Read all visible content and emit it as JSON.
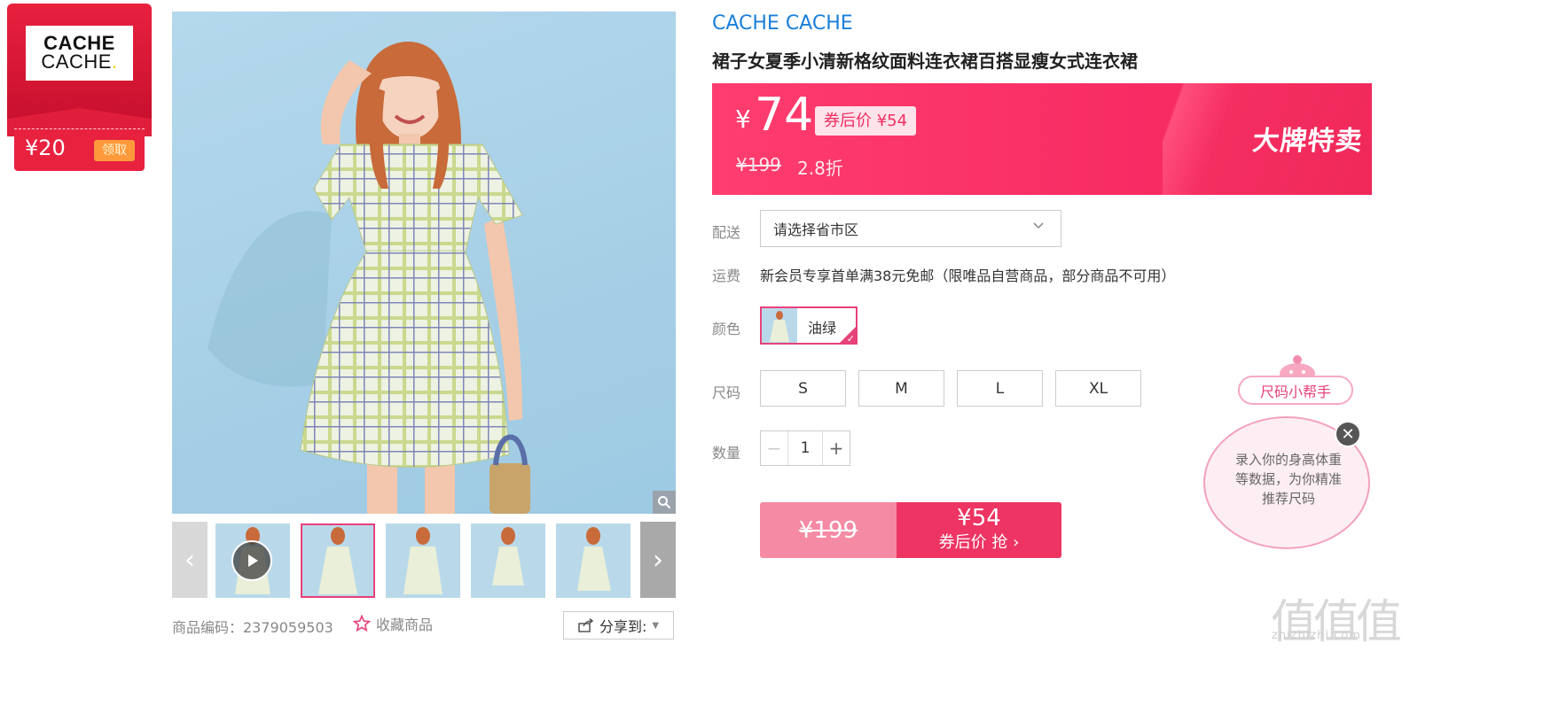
{
  "store": {
    "logo_line1": "CACHE",
    "logo_line2": "CACHE",
    "logo_dot": ".",
    "coupon_amount": "¥20",
    "coupon_button": "领取"
  },
  "gallery": {
    "thumb_prev_icon": "chevron-left-icon",
    "thumb_next_icon": "chevron-right-icon",
    "zoom_icon": "magnifier-icon",
    "play_icon": "play-icon",
    "thumbnail_count": 5,
    "active_thumbnail_index": 1
  },
  "footer": {
    "product_code": "商品编码：2379059503",
    "favorite_label": "收藏商品",
    "share_label": "分享到:"
  },
  "product": {
    "brand": "CACHE CACHE",
    "title": "裙子女夏季小清新格纹面料连衣裙百搭显瘦女式连衣裙"
  },
  "price": {
    "currency": "¥",
    "current": "74",
    "coupon_price_tag": "券后价 ¥54",
    "original": "¥199",
    "discount": "2.8折",
    "banner_label": "大牌特卖"
  },
  "delivery": {
    "label": "配送",
    "placeholder": "请选择省市区"
  },
  "shipping": {
    "label": "运费",
    "text": "新会员专享首单满38元免邮（限唯品自营商品，部分商品不可用）"
  },
  "color": {
    "label": "颜色",
    "selected": "油绿"
  },
  "size": {
    "label": "尺码",
    "options": [
      "S",
      "M",
      "L",
      "XL"
    ]
  },
  "quantity": {
    "label": "数量",
    "minus": "−",
    "value": "1",
    "plus": "+"
  },
  "buy": {
    "original_price": "¥199",
    "coupon_price": "¥54",
    "coupon_action": "券后价 抢 ›"
  },
  "size_helper": {
    "tag": "尺码小帮手",
    "bubble_text": "录入你的身高体重等数据，为你精准推荐尺码",
    "close": "✕"
  },
  "watermark": {
    "logo": "值值值",
    "url": "zhizhizhi.com"
  },
  "colors": {
    "accent_pink": "#ed3463",
    "brand_blue": "#1a7fd9",
    "store_red": "#e8213f"
  }
}
